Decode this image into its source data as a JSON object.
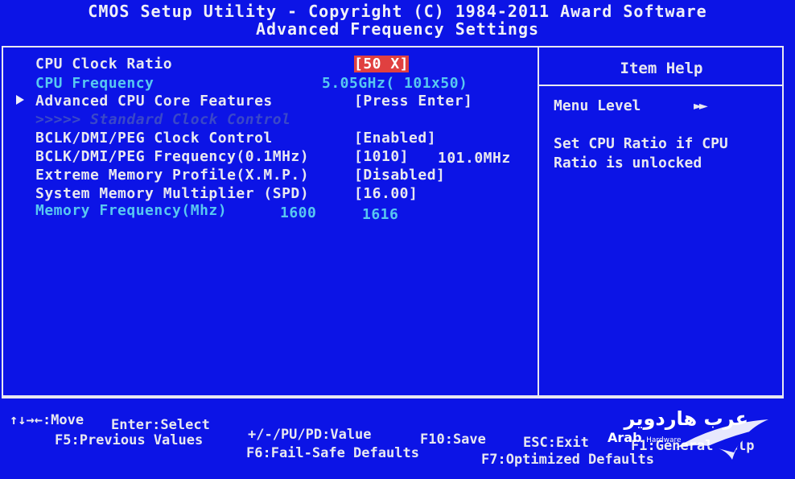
{
  "header": {
    "line1": "CMOS Setup Utility - Copyright (C) 1984-2011 Award Software",
    "line2": "Advanced Frequency Settings"
  },
  "settings": {
    "cpu_clock_ratio": {
      "label": "CPU Clock Ratio",
      "value": "[50 X]"
    },
    "cpu_frequency": {
      "label": "CPU Frequency",
      "value": "5.05GHz( 101x50)"
    },
    "advanced_cpu": {
      "label": "Advanced CPU Core Features",
      "value": "[Press Enter]"
    },
    "standard_clock": {
      "label": ">>>>>  Standard Clock Control"
    },
    "bclk_control": {
      "label": "BCLK/DMI/PEG Clock Control",
      "value": "[Enabled]"
    },
    "bclk_freq": {
      "label": "BCLK/DMI/PEG Frequency(0.1MHz)",
      "value": "[1010]",
      "extra": "101.0MHz"
    },
    "xmp": {
      "label": "Extreme Memory Profile(X.M.P.)",
      "value": "[Disabled]"
    },
    "mem_mult": {
      "label": "System Memory Multiplier (SPD)",
      "value": "[16.00]"
    },
    "mem_freq": {
      "label": "Memory Frequency(Mhz)",
      "value1": "1600",
      "value2": "1616"
    }
  },
  "help": {
    "title": "Item Help",
    "menu_level_label": "Menu Level",
    "menu_level_arrows": "►►",
    "line1": "Set CPU Ratio if CPU",
    "line2": "Ratio is unlocked"
  },
  "footer": {
    "move": "↑↓→←:Move",
    "enter": "Enter:Select",
    "value": "+/-/PU/PD:Value",
    "save": "F10:Save",
    "esc": "ESC:Exit",
    "f1": "F1:General Help",
    "f5": "F5:Previous Values",
    "f6": "F6:Fail-Safe Defaults",
    "f7": "F7:Optimized Defaults"
  },
  "watermark": {
    "arabic": "عرب هاردوير",
    "english": "Arab",
    "english_small": "Hardware"
  },
  "colors": {
    "background": "#0c14e6",
    "text": "#e8e8f0",
    "highlight": "#58c8f0",
    "selection": "#e04040"
  }
}
